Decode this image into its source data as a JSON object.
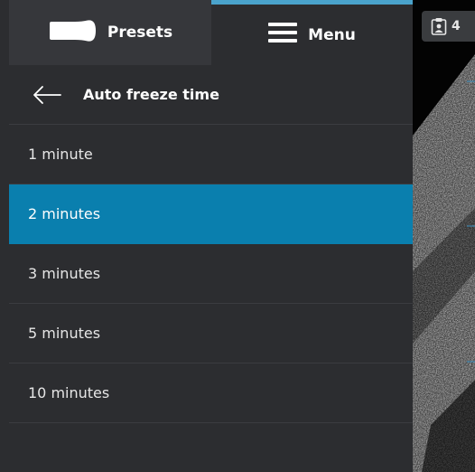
{
  "tabs": {
    "presets_label": "Presets",
    "menu_label": "Menu",
    "active": "menu"
  },
  "header": {
    "title": "Auto freeze time"
  },
  "options": [
    {
      "label": "1 minute",
      "selected": false
    },
    {
      "label": "2 minutes",
      "selected": true
    },
    {
      "label": "3 minutes",
      "selected": false
    },
    {
      "label": "5 minutes",
      "selected": false
    },
    {
      "label": "10 minutes",
      "selected": false
    }
  ],
  "patient": {
    "count": "4",
    "icon": "patient-clipboard-icon"
  },
  "colors": {
    "panel_bg": "#2c2d30",
    "selected_bg": "#0a7fae",
    "tab_accent": "#4aa3cc"
  }
}
